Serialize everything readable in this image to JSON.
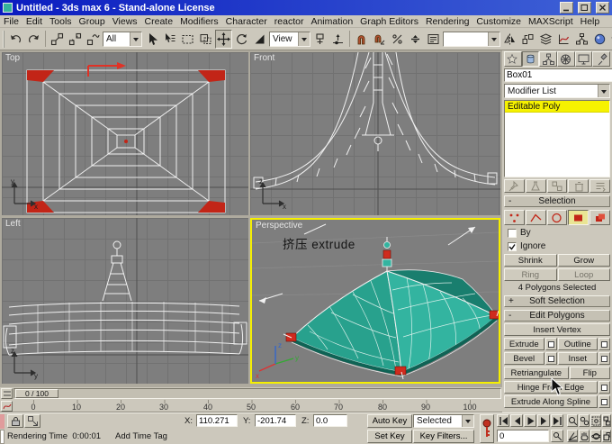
{
  "window": {
    "title": "Untitled - 3ds max 6 - Stand-alone License"
  },
  "menu": {
    "items": [
      "File",
      "Edit",
      "Tools",
      "Group",
      "Views",
      "Create",
      "Modifiers",
      "Character",
      "reactor",
      "Animation",
      "Graph Editors",
      "Rendering",
      "Customize",
      "MAXScript",
      "Help"
    ]
  },
  "toolbar": {
    "selection_filter": "All",
    "coord_system": "View",
    "named_selection": ""
  },
  "viewports": {
    "top": {
      "label": "Top"
    },
    "front": {
      "label": "Front"
    },
    "left": {
      "label": "Left"
    },
    "perspective": {
      "label": "Perspective",
      "annotation": "挤压 extrude"
    }
  },
  "axes": {
    "x": "x",
    "y": "y",
    "z": "z"
  },
  "command_panel": {
    "object_name": "Box01",
    "modifier_list": "Modifier List",
    "stack_item": "Editable Poly",
    "rollouts": {
      "selection": {
        "sign": "-",
        "title": "Selection"
      },
      "soft_selection": {
        "sign": "+",
        "title": "Soft Selection"
      },
      "edit_polygons": {
        "sign": "-",
        "title": "Edit Polygons"
      }
    },
    "selection": {
      "by": "By",
      "ignore": "Ignore",
      "shrink": "Shrink",
      "grow": "Grow",
      "ring": "Ring",
      "loop": "Loop",
      "status": "4 Polygons Selected"
    },
    "edit_polygons": {
      "insert_vertex": "Insert Vertex",
      "extrude": "Extrude",
      "outline": "Outline",
      "bevel": "Bevel",
      "inset": "Inset",
      "retriangulate": "Retriangulate",
      "flip": "Flip",
      "hinge_from_edge": "Hinge From Edge",
      "extrude_along_spline": "Extrude Along Spline"
    }
  },
  "timeline": {
    "thumb": "0 / 100",
    "ticks": [
      "0",
      "10",
      "20",
      "30",
      "40",
      "50",
      "60",
      "70",
      "80",
      "90",
      "100"
    ]
  },
  "status": {
    "x_label": "X:",
    "x_value": "110.271",
    "y_label": "Y:",
    "y_value": "-201.74",
    "z_label": "Z:",
    "z_value": "0.0",
    "line": "Rendering Time  0:00:01",
    "time_tag": "Add Time Tag",
    "auto_key": "Auto Key",
    "set_key": "Set Key",
    "key_mode": "Selected",
    "key_filters": "Key Filters...",
    "frame": "0"
  },
  "colors": {
    "object_color": "#35b39d",
    "selection_red": "#c22517",
    "active_viewport_border": "#f5ef00",
    "stack_highlight": "#f6f200"
  }
}
